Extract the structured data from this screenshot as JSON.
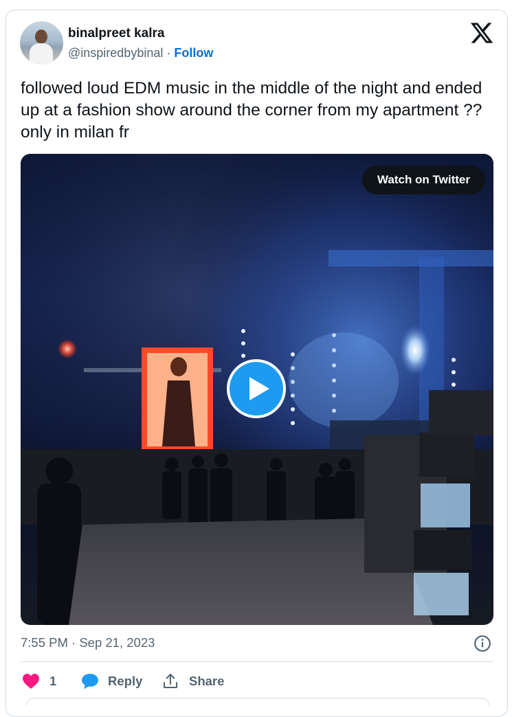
{
  "author": {
    "name": "binalpreet kalra",
    "handle": "@inspiredbybinal",
    "separator": "·",
    "follow_label": "Follow"
  },
  "tweet": {
    "text": "followed loud EDM music in the middle of the night and ended up at a fashion show around the corner from my apartment ?? only in milan fr"
  },
  "media": {
    "watch_label": "Watch on Twitter",
    "icon": "play-icon"
  },
  "meta": {
    "timestamp": "7:55 PM · Sep 21, 2023"
  },
  "actions": {
    "like_count": "1",
    "reply_label": "Reply",
    "share_label": "Share"
  },
  "colors": {
    "accent": "#1d9bf0",
    "follow": "#006fd6",
    "like": "#f91880",
    "text": "#0f1419",
    "muted": "#536471"
  }
}
